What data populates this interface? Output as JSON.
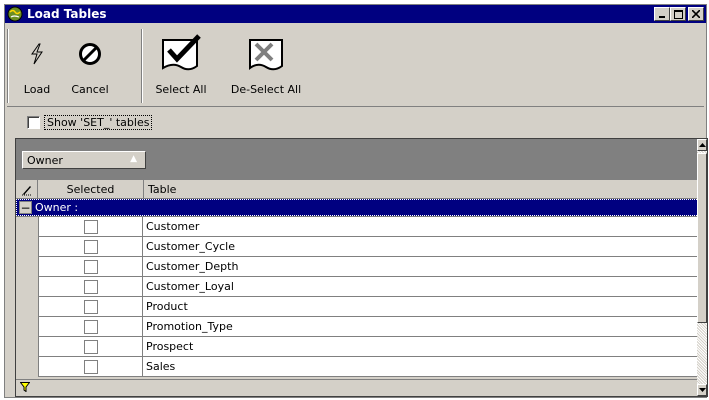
{
  "window": {
    "title": "Load Tables",
    "icon": "app-globe-icon"
  },
  "toolbar": {
    "load_label": "Load",
    "cancel_label": "Cancel",
    "select_all_label": "Select All",
    "deselect_all_label": "De-Select All"
  },
  "options": {
    "show_set_label": "Show 'SET_' tables",
    "show_set_checked": false
  },
  "grid": {
    "group_by_label": "Owner",
    "columns": [
      "Selected",
      "Table"
    ],
    "group_label": "Owner :",
    "rows": [
      {
        "selected": false,
        "table": "Customer"
      },
      {
        "selected": false,
        "table": "Customer_Cycle"
      },
      {
        "selected": false,
        "table": "Customer_Depth"
      },
      {
        "selected": false,
        "table": "Customer_Loyal"
      },
      {
        "selected": false,
        "table": "Product"
      },
      {
        "selected": false,
        "table": "Promotion_Type"
      },
      {
        "selected": false,
        "table": "Prospect"
      },
      {
        "selected": false,
        "table": "Sales"
      }
    ]
  },
  "colors": {
    "titlebar": "#000080",
    "face": "#d4d0c8",
    "group_row": "#000080"
  }
}
